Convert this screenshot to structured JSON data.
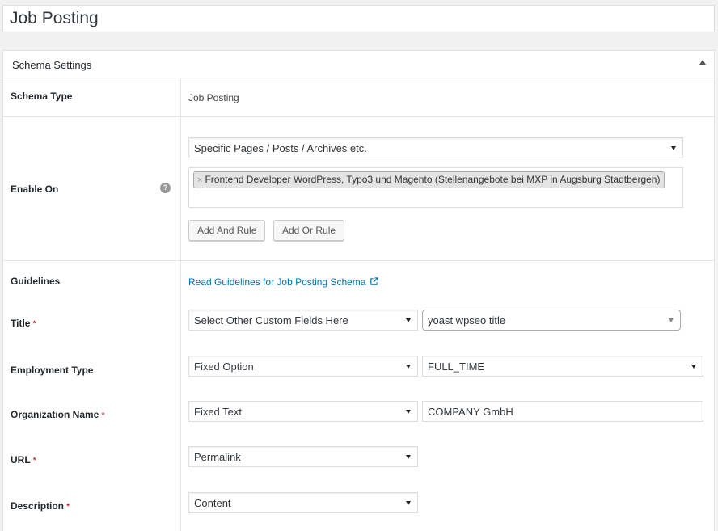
{
  "page": {
    "title": "Job Posting"
  },
  "panel": {
    "header": "Schema Settings",
    "toggle_icon": "triangle-up-icon"
  },
  "schema_type": {
    "label": "Schema Type",
    "value": "Job Posting"
  },
  "enable_on": {
    "label": "Enable On",
    "help_icon": "question-circle-icon",
    "condition_select": "Specific Pages / Posts / Archives etc.",
    "selected_items": [
      "Frontend Developer WordPress, Typo3 und Magento (Stellenangebote bei MXP in Augsburg Stadtbergen)"
    ],
    "chip_remove_glyph": "×",
    "add_and_rule": "Add And Rule",
    "add_or_rule": "Add Or Rule"
  },
  "guidelines": {
    "label": "Guidelines",
    "link_text": "Read Guidelines for Job Posting Schema",
    "link_icon": "external-link-icon"
  },
  "fields": {
    "required_marker": "*",
    "title": {
      "label": "Title",
      "required": true,
      "source": "Select Other Custom Fields Here",
      "value": "yoast wpseo title"
    },
    "employment_type": {
      "label": "Employment Type",
      "required": false,
      "source": "Fixed Option",
      "value": "FULL_TIME"
    },
    "organization_name": {
      "label": "Organization Name",
      "required": true,
      "source": "Fixed Text",
      "value": "COMPANY GmbH"
    },
    "url": {
      "label": "URL",
      "required": true,
      "source": "Permalink"
    },
    "description": {
      "label": "Description",
      "required": true,
      "source": "Content"
    }
  },
  "colors": {
    "link": "#0073aa",
    "required": "#aa0000",
    "background": "#f1f1f1"
  }
}
